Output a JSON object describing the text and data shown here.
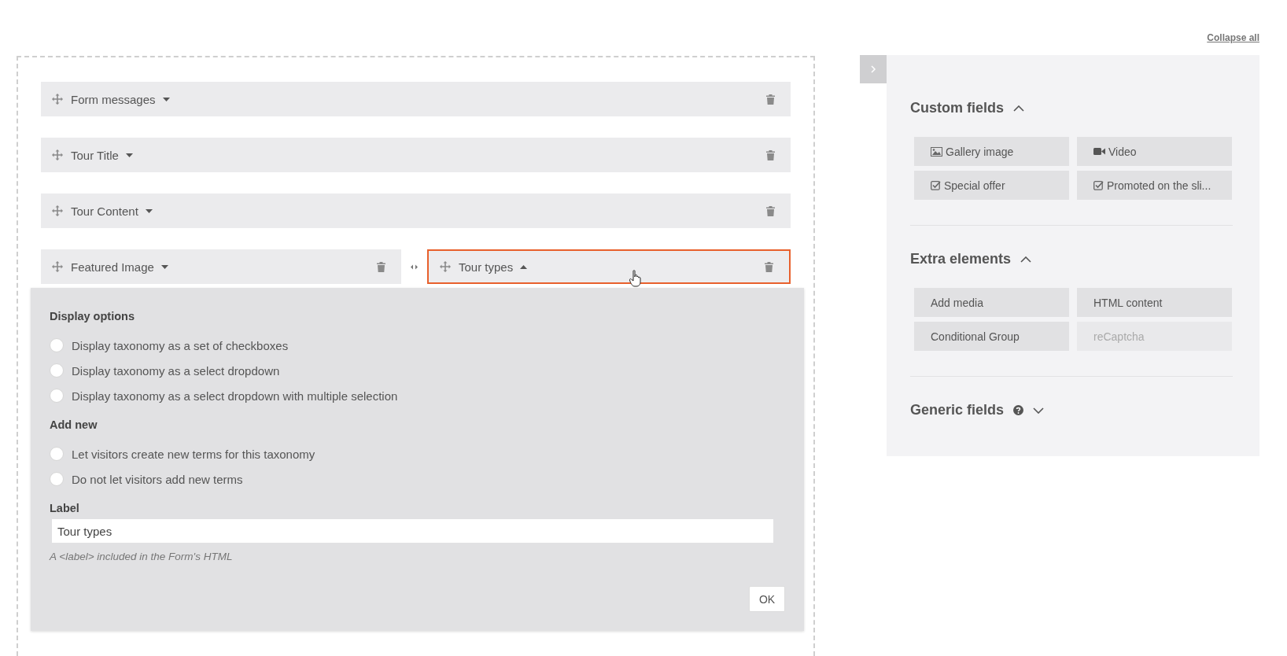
{
  "collapse_all": "Collapse all",
  "form_rows": [
    {
      "fields": [
        {
          "label": "Form messages",
          "expanded": false,
          "selected": false
        }
      ]
    },
    {
      "fields": [
        {
          "label": "Tour Title",
          "expanded": false,
          "selected": false
        }
      ]
    },
    {
      "fields": [
        {
          "label": "Tour Content",
          "expanded": false,
          "selected": false
        }
      ]
    },
    {
      "fields": [
        {
          "label": "Featured Image",
          "expanded": false,
          "selected": false
        },
        {
          "label": "Tour types",
          "expanded": true,
          "selected": true
        }
      ]
    }
  ],
  "field_settings": {
    "sections": [
      {
        "title": "Display options",
        "options": [
          {
            "label": "Display taxonomy as a set of checkboxes",
            "selected": false
          },
          {
            "label": "Display taxonomy as a select dropdown",
            "selected": false
          },
          {
            "label": "Display taxonomy as a select dropdown with multiple selection",
            "selected": false
          }
        ]
      },
      {
        "title": "Add new",
        "options": [
          {
            "label": "Let visitors create new terms for this taxonomy",
            "selected": false
          },
          {
            "label": "Do not let visitors add new terms",
            "selected": false
          }
        ]
      }
    ],
    "label_title": "Label",
    "label_value": "Tour types",
    "label_hint": "A <label> included in the Form's HTML",
    "ok": "OK"
  },
  "sidebar": {
    "sections": [
      {
        "title": "Custom fields",
        "expanded": true,
        "help": false,
        "items": [
          {
            "label": "Gallery image",
            "kind": "image",
            "disabled": false
          },
          {
            "label": "Video",
            "kind": "video",
            "disabled": false
          },
          {
            "label": "Special offer",
            "kind": "checkbox",
            "disabled": false
          },
          {
            "label": "Promoted on the sli...",
            "kind": "checkbox",
            "disabled": false
          }
        ]
      },
      {
        "title": "Extra elements",
        "expanded": true,
        "help": false,
        "items": [
          {
            "label": "Add media",
            "disabled": false
          },
          {
            "label": "HTML content",
            "disabled": false
          },
          {
            "label": "Conditional Group",
            "disabled": false
          },
          {
            "label": "reCaptcha",
            "disabled": true
          }
        ]
      },
      {
        "title": "Generic fields",
        "expanded": false,
        "help": true
      }
    ]
  }
}
